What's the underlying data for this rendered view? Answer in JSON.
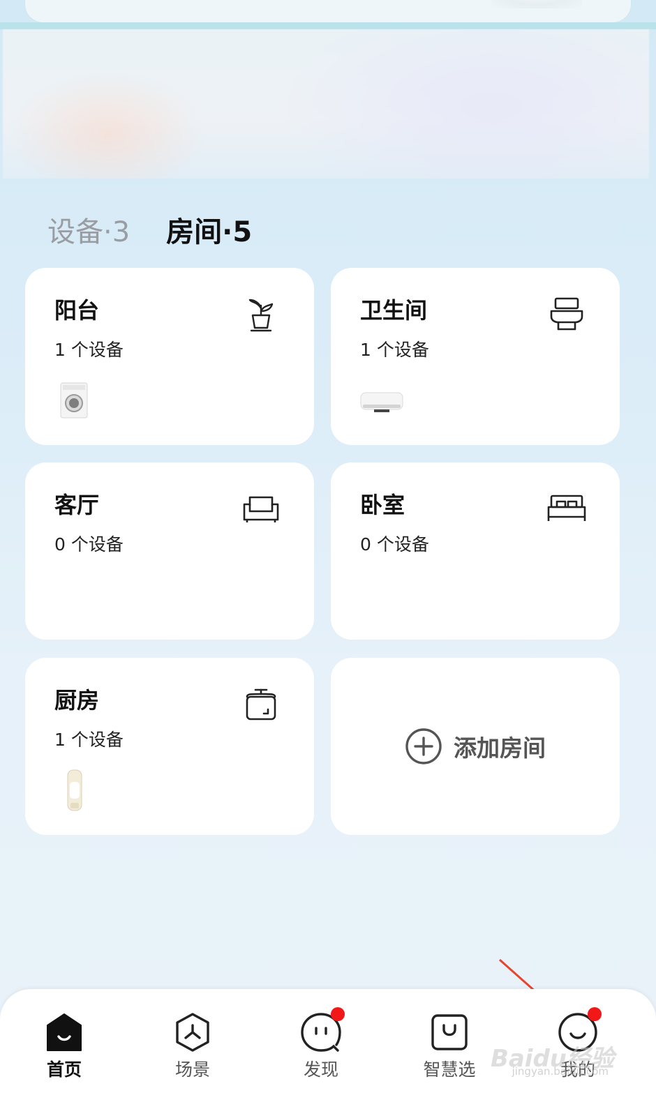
{
  "tabs": [
    {
      "label": "设备·3",
      "active": false
    },
    {
      "label": "房间·5",
      "active": true
    }
  ],
  "rooms": [
    {
      "name": "阳台",
      "count": "1 个设备",
      "icon": "plant-pot-icon",
      "device": "washing-machine"
    },
    {
      "name": "卫生间",
      "count": "1 个设备",
      "icon": "toilet-icon",
      "device": "water-heater"
    },
    {
      "name": "客厅",
      "count": "0 个设备",
      "icon": "sofa-icon"
    },
    {
      "name": "卧室",
      "count": "0 个设备",
      "icon": "bed-icon"
    },
    {
      "name": "厨房",
      "count": "1 个设备",
      "icon": "rice-cooker-icon",
      "device": "dispenser"
    }
  ],
  "add_room": {
    "label": "添加房间",
    "icon": "plus-circle-icon"
  },
  "nav": [
    {
      "label": "首页",
      "icon": "home-icon",
      "active": true,
      "badge": false
    },
    {
      "label": "场景",
      "icon": "scene-hexagon-icon",
      "active": false,
      "badge": false
    },
    {
      "label": "发现",
      "icon": "discover-face-icon",
      "active": false,
      "badge": true
    },
    {
      "label": "智慧选",
      "icon": "shopping-bag-icon",
      "active": false,
      "badge": false
    },
    {
      "label": "我的",
      "icon": "smile-profile-icon",
      "active": false,
      "badge": true
    }
  ],
  "watermark": {
    "brand": "Baidu经验",
    "url": "jingyan.baidu.com"
  },
  "colors": {
    "badge": "#f21818",
    "annotation_arrow": "#e8432e"
  }
}
